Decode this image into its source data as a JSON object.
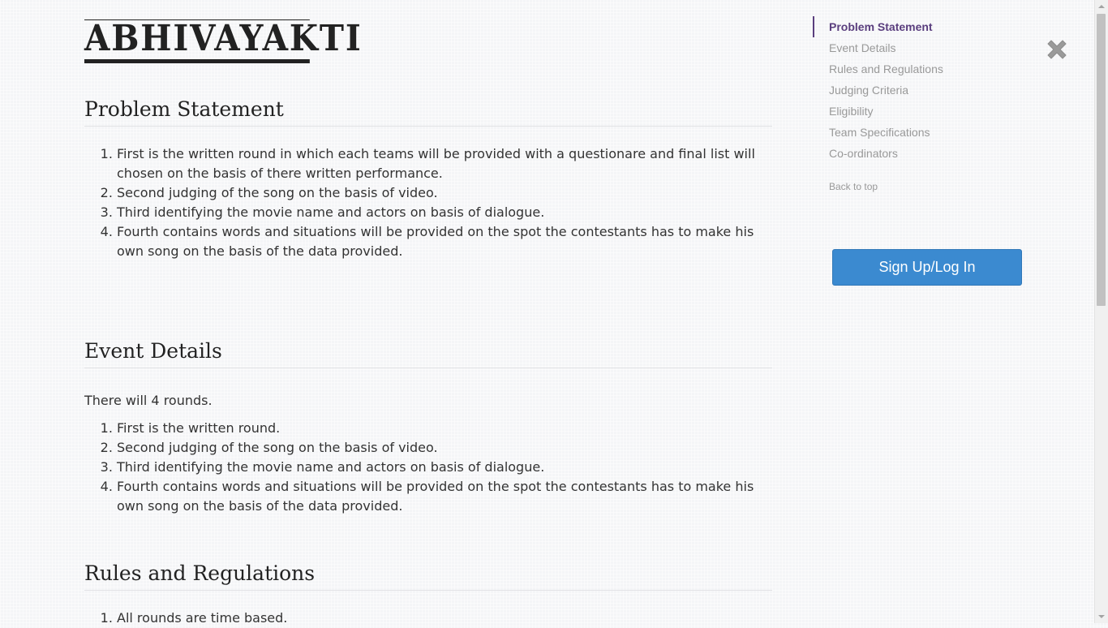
{
  "logo": {
    "text": "Abhivayakti"
  },
  "sections": [
    {
      "title": "Problem Statement",
      "items": [
        "First is the written round in which each teams will be provided with a questionare and final list will chosen on the basis of there written performance.",
        "Second judging of the song on the basis of video.",
        "Third identifying the movie name and actors on basis of dialogue.",
        "Fourth contains words and situations will be provided on the spot the contestants has to make his own song on the basis of the data provided."
      ]
    },
    {
      "title": "Event Details",
      "intro": "There will 4 rounds.",
      "items": [
        "First is the written round.",
        "Second judging of the song on the basis of video.",
        "Third identifying the movie name and actors on basis of dialogue.",
        "Fourth contains words and situations will be provided on the spot the contestants has to make his own song on the basis of the data provided."
      ]
    },
    {
      "title": "Rules and Regulations",
      "items": [
        "All rounds are time based."
      ]
    }
  ],
  "toc": {
    "items": [
      "Problem Statement",
      "Event Details",
      "Rules and Regulations",
      "Judging Criteria",
      "Eligibility",
      "Team Specifications",
      "Co-ordinators"
    ],
    "active": "Problem Statement",
    "back_to_top": "Back to top"
  },
  "signup_button": "Sign Up/Log In",
  "colors": {
    "accent": "#5a3e7e",
    "button": "#3b8ad0",
    "toc_inactive": "#999999"
  },
  "icons": {
    "close": "close-icon"
  }
}
